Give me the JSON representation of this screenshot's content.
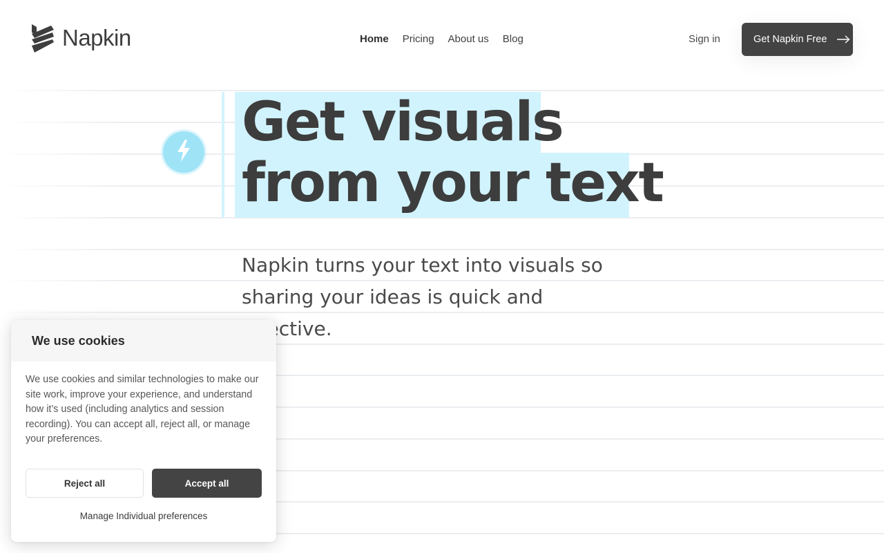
{
  "brand": {
    "name": "Napkin",
    "logo_icon": "napkin-stripes-logo",
    "accent_color": "#434343",
    "highlight_color": "#d1f3fd",
    "badge_color": "#9fe3f7"
  },
  "nav": {
    "items": [
      {
        "label": "Home",
        "active": true
      },
      {
        "label": "Pricing",
        "active": false
      },
      {
        "label": "About us",
        "active": false
      },
      {
        "label": "Blog",
        "active": false
      }
    ],
    "sign_in": "Sign in",
    "cta_label": "Get Napkin Free",
    "cta_icon": "arrow-right-icon"
  },
  "hero": {
    "badge_icon": "lightning-bolt-icon",
    "title_line1": "Get visuals",
    "title_line2": "from your text",
    "subtitle": "Napkin turns your text into visuals so sharing your ideas is quick and effective."
  },
  "cookie_banner": {
    "title": "We use cookies",
    "body": "We use cookies and similar technologies to make our site work, improve your experience, and understand how it’s used (including analytics and session recording). You can accept all, reject all, or manage your preferences.",
    "reject_label": "Reject all",
    "accept_label": "Accept all",
    "manage_label": "Manage Individual preferences"
  }
}
